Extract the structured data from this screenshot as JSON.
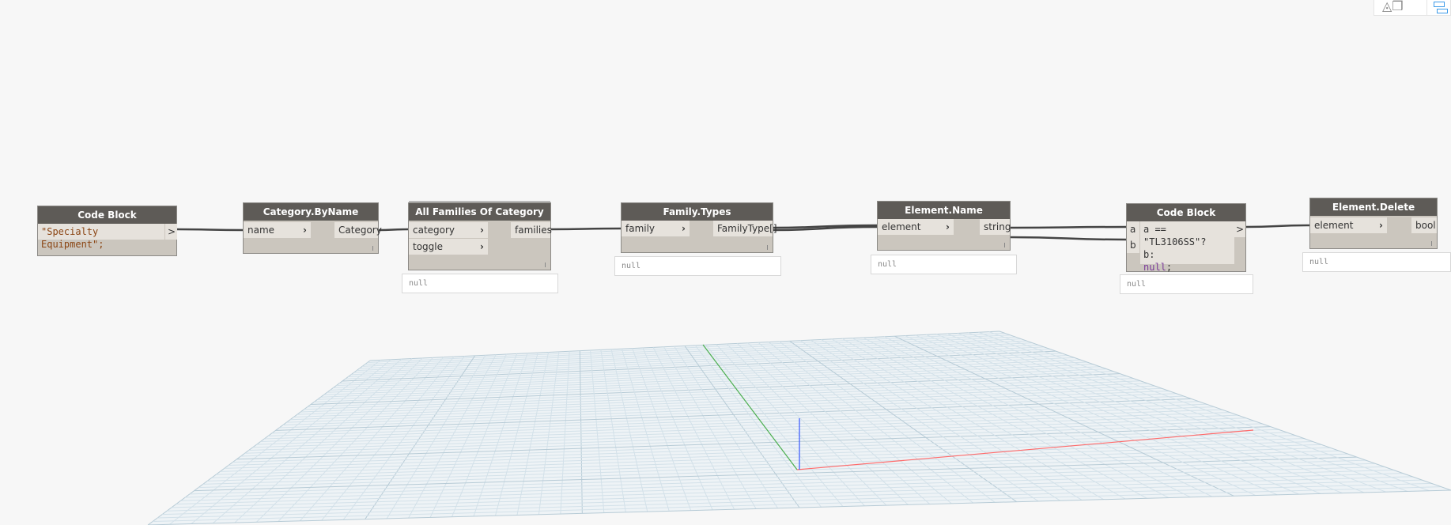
{
  "nodes": {
    "code_block_1": {
      "title": "Code Block",
      "code": "\"Specialty Equipment\";",
      "output": ">"
    },
    "category_by_name": {
      "title": "Category.ByName",
      "input": "name",
      "output": "Category"
    },
    "all_families": {
      "title": "All Families Of Category",
      "inputs": [
        "category",
        "toggle"
      ],
      "output": "families",
      "preview": "null"
    },
    "family_types": {
      "title": "Family.Types",
      "input": "family",
      "output": "FamilyType[]",
      "preview": "null"
    },
    "element_name": {
      "title": "Element.Name",
      "input": "element",
      "output": "string",
      "preview": "null"
    },
    "code_block_2": {
      "title": "Code Block",
      "inputs": [
        "a",
        "b"
      ],
      "code_line1": "a == \"TL3106SS\"?",
      "code_line2": "b:",
      "code_null": "null",
      "code_semi": ";",
      "output": ">",
      "preview": "null"
    },
    "element_delete": {
      "title": "Element.Delete",
      "input": "element",
      "output": "bool",
      "preview": "null"
    }
  },
  "colors": {
    "header": "#5e5b57",
    "body": "#cbc6be",
    "port": "#e6e2dc",
    "wire": "#444444",
    "grid": "#c9dce6",
    "axis_x": "#ff6b6b",
    "axis_y": "#4caf50",
    "axis_z": "#3355ff"
  }
}
